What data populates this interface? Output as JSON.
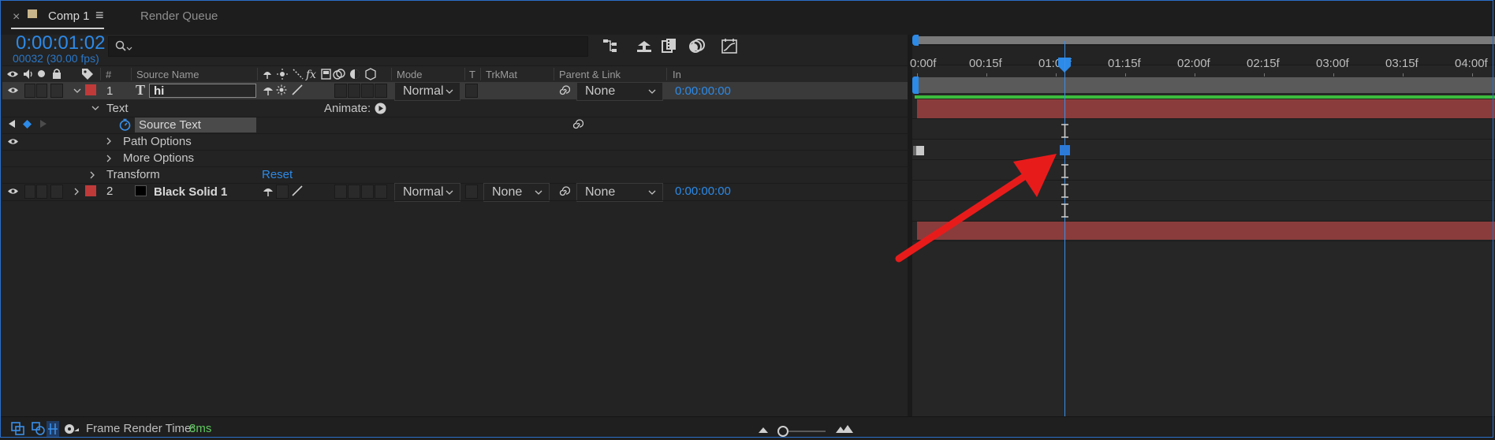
{
  "tabs": {
    "close_glyph": "×",
    "active": "Comp 1",
    "menu_glyph": "≡",
    "inactive": "Render Queue"
  },
  "timecode": {
    "current": "0:00:01:02",
    "frames": "00032 (30.00 fps)"
  },
  "search": {
    "placeholder": ""
  },
  "columns": {
    "number": "#",
    "source_name": "Source Name",
    "mode": "Mode",
    "t": "T",
    "trkmat": "TrkMat",
    "parent_link": "Parent & Link",
    "in": "In"
  },
  "layers": [
    {
      "number": "1",
      "type_glyph": "T",
      "name": "hi",
      "mode": "Normal",
      "parent": "None",
      "in": "0:00:00:00",
      "color": "#c03a3a"
    },
    {
      "number": "2",
      "name": "Black Solid 1",
      "mode": "Normal",
      "trkmat": "None",
      "parent": "None",
      "in": "0:00:00:00",
      "color": "#c03a3a"
    }
  ],
  "properties": {
    "text": "Text",
    "animate": "Animate:",
    "source_text": "Source Text",
    "path_options": "Path Options",
    "more_options": "More Options",
    "transform": "Transform",
    "reset": "Reset"
  },
  "ruler": [
    "0:00f",
    "00:15f",
    "01:00f",
    "01:15f",
    "02:00f",
    "02:15f",
    "03:00f",
    "03:15f",
    "04:00f"
  ],
  "playhead_time_fraction": 0.258,
  "bottom": {
    "label": "Frame Render Time:",
    "value": "8ms"
  },
  "colors": {
    "accent": "#2c8ae8",
    "layer_bar": "#8a3c3c",
    "work_area": "#3dbb3d",
    "arrow": "#e81b1b"
  }
}
